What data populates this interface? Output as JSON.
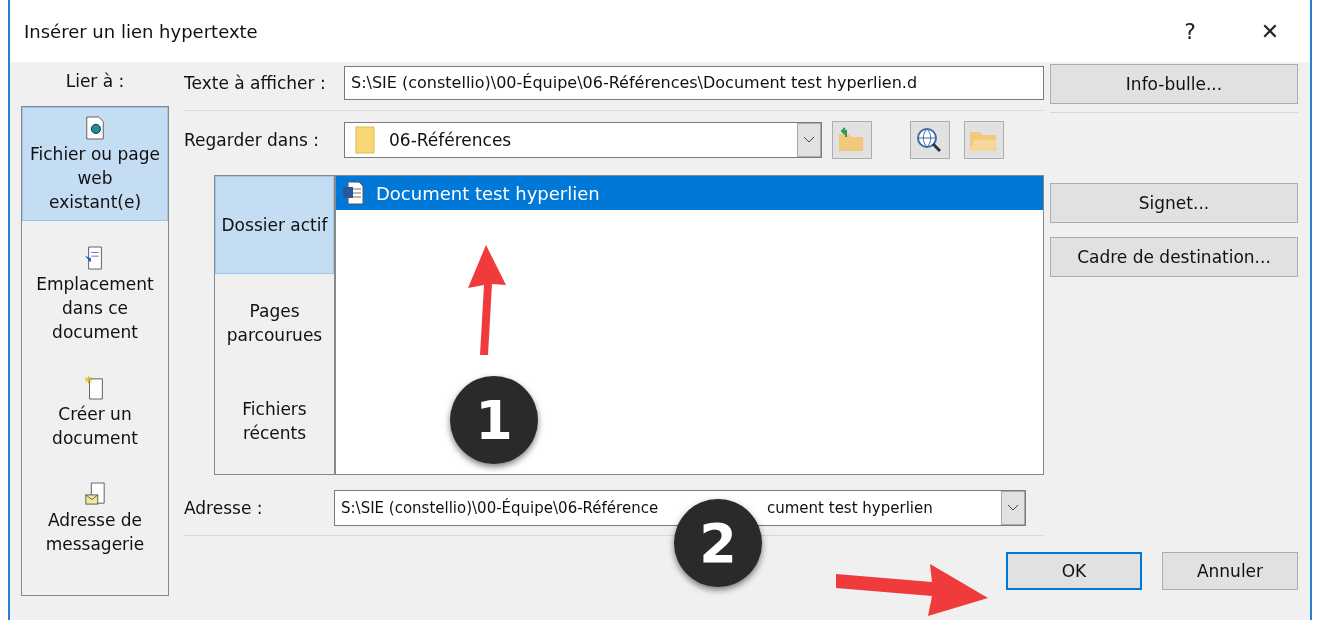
{
  "window": {
    "title": "Insérer un lien hypertexte",
    "help": "?",
    "close": "✕"
  },
  "link_to": {
    "label": "Lier à :",
    "items": [
      {
        "label": "Fichier ou page web existant(e)",
        "kind": "file",
        "selected": true
      },
      {
        "label": "Emplacement dans ce document",
        "kind": "place",
        "selected": false
      },
      {
        "label": "Créer un document",
        "kind": "new",
        "selected": false
      },
      {
        "label": "Adresse de messagerie",
        "kind": "mail",
        "selected": false
      }
    ]
  },
  "display_text": {
    "label": "Texte à afficher :",
    "value": "S:\\SIE (constellio)\\00-Équipe\\06-Références\\Document test hyperlien.d"
  },
  "look_in": {
    "label": "Regarder dans :",
    "value": "06-Références"
  },
  "sources": [
    {
      "label": "Dossier actif",
      "selected": true
    },
    {
      "label": "Pages parcourues",
      "selected": false
    },
    {
      "label": "Fichiers récents",
      "selected": false
    }
  ],
  "files": [
    {
      "name": "Document test hyperlien",
      "selected": true
    }
  ],
  "address": {
    "label": "Adresse :",
    "value_start": "S:\\SIE (constellio)\\00-Équipe\\06-Référence",
    "value_end": "cument test hyperlien"
  },
  "side_buttons": [
    "Info-bulle...",
    "Signet...",
    "Cadre de destination..."
  ],
  "buttons": [
    {
      "label": "OK",
      "default": true
    },
    {
      "label": "Annuler",
      "default": false
    }
  ],
  "annotations": [
    {
      "label": "1"
    },
    {
      "label": "2"
    }
  ]
}
